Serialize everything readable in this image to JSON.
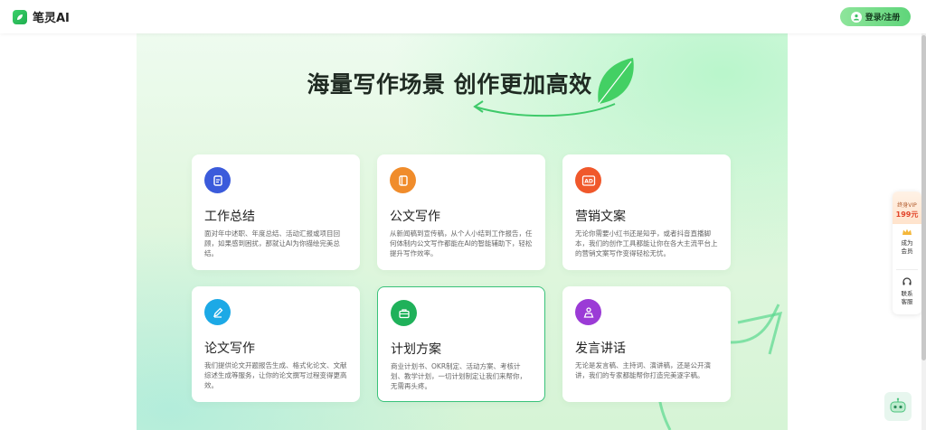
{
  "header": {
    "logo_text": "笔灵AI",
    "login_label": "登录/注册"
  },
  "main": {
    "title": "海量写作场景 创作更加高效"
  },
  "cards": [
    {
      "title": "工作总结",
      "desc": "面对年中述职、年度总结、活动汇报或项目回顾，如果感到困扰，那就让AI为你描绘完美总结。",
      "color": "#3b5bdb"
    },
    {
      "title": "公文写作",
      "desc": "从新闻稿到宣传稿，从个人小结到工作报告，任何体制内公文写作都能在AI的智能辅助下，轻松提升写作效率。",
      "color": "#f08c2b"
    },
    {
      "title": "营销文案",
      "desc": "无论你需要小红书还是知乎，或者抖音直播脚本，我们的创作工具都能让你在各大主流平台上的营销文案写作变得轻松无忧。",
      "color": "#f0582b"
    },
    {
      "title": "论文写作",
      "desc": "我们提供论文开题报告生成、格式化论文、文献综述生成等服务，让你的论文撰写过程变得更高效。",
      "color": "#1ca9e6"
    },
    {
      "title": "计划方案",
      "desc": "商业计划书、OKR制定、活动方案、考核计划、教学计划，一切计划制定让我们来帮你，无需再头疼。",
      "color": "#1fb15a"
    },
    {
      "title": "发言讲话",
      "desc": "无论是发言稿、主持词、演讲稿，还是公开演讲，我们的专家都能帮你打造完美逐字稿。",
      "color": "#9b3bd6"
    }
  ],
  "rail": {
    "vip_line1": "终身VIP",
    "vip_price": "199元",
    "member_line1": "成为",
    "member_line2": "会员",
    "service_line1": "联系",
    "service_line2": "客服"
  },
  "colors": {
    "brand_green": "#2fc15f",
    "active_border": "#39c27a"
  }
}
